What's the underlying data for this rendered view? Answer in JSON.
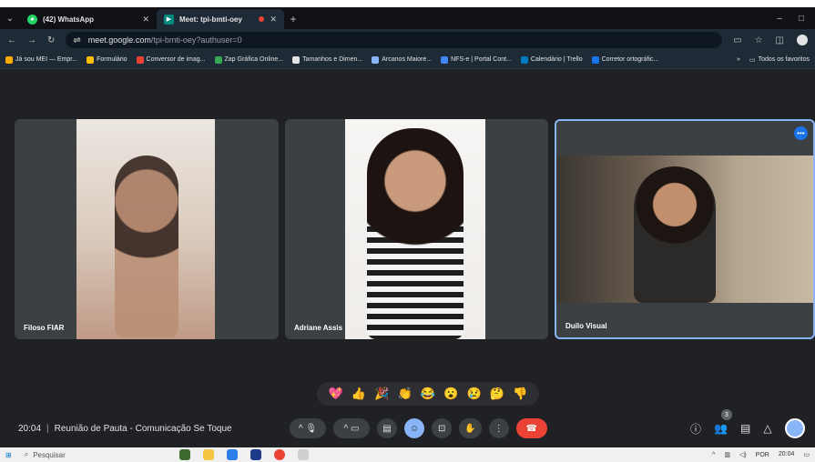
{
  "browser": {
    "tabs": [
      {
        "title": "(42) WhatsApp",
        "icon": "whatsapp-icon",
        "active": false
      },
      {
        "title": "Meet: tpi-bmti-oey",
        "icon": "meet-icon",
        "active": true
      }
    ],
    "new_tab": "+",
    "window_controls": [
      "–",
      "□"
    ],
    "url": "meet.google.com",
    "url_path": "/tpi-bmti-oey?authuser=0",
    "bookmarks": [
      {
        "label": "Já sou MEI — Empr...",
        "color": "#f9ab00"
      },
      {
        "label": "Formulário",
        "color": "#fbbc04"
      },
      {
        "label": "Conversor de imag...",
        "color": "#ea4335"
      },
      {
        "label": "Zap Gráfica Online...",
        "color": "#34a853"
      },
      {
        "label": "Tamanhos e Dimen...",
        "color": "#e3e3e3"
      },
      {
        "label": "Arcanos Maiore...",
        "color": "#8ab4f8"
      },
      {
        "label": "NFS-e | Portal Cont...",
        "color": "#4285f4"
      },
      {
        "label": "Calendário | Trello",
        "color": "#0079bf"
      },
      {
        "label": "Corretor ortográfic...",
        "color": "#1a73e8"
      }
    ],
    "bookmarks_more": "»",
    "all_bookmarks": "Todos os favoritos"
  },
  "participants": [
    {
      "name": "Filoso FIAR",
      "bg": "#e8e2dc"
    },
    {
      "name": "Adriane Assis",
      "bg": "#f2f0ee"
    },
    {
      "name": "Duílo Visual",
      "bg": "#5a5046"
    }
  ],
  "reactions": [
    "💖",
    "👍",
    "🎉",
    "👏",
    "😂",
    "😮",
    "😢",
    "🤔",
    "👎"
  ],
  "meeting": {
    "time": "20:04",
    "title": "Reunião de Pauta - Comunicação Se Toque"
  },
  "people_count": "3",
  "taskbar": {
    "search_placeholder": "Pesquisar",
    "lang": "POR",
    "clock_time": "20:04"
  },
  "colors": {
    "background": "#202124",
    "tile": "#3c4043",
    "accent": "#8ab4f8",
    "end_call": "#ea4335"
  }
}
